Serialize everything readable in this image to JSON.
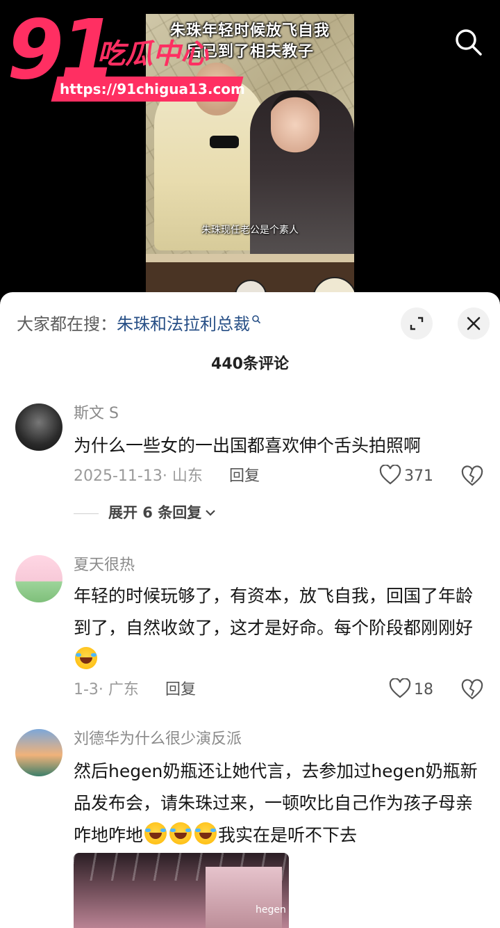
{
  "video": {
    "title_line1": "朱珠年轻时候放飞自我",
    "title_line2": "后已到了相夫教子",
    "caption": "朱珠现任老公是个素人"
  },
  "watermark": {
    "number": "91",
    "name": "吃瓜中心",
    "url": "https://91chigua13.com",
    "color": "#ff2f62"
  },
  "header": {
    "search_icon": "search-icon"
  },
  "sheet": {
    "search_label": "大家都在搜：",
    "search_term": "朱珠和法拉利总裁",
    "search_term_color": "#274f86",
    "expand_icon": "expand-icon",
    "close_icon": "close-icon",
    "count": "440条评论"
  },
  "comments": [
    {
      "user": "斯文 S",
      "text": "为什么一些女的一出国都喜欢伸个舌头拍照啊",
      "meta": "2025-11-13· 山东",
      "reply": "回复",
      "likes": "371",
      "expand": "展开 6 条回复"
    },
    {
      "user": "夏天很热",
      "text": "年轻的时候玩够了，有资本，放飞自我，回国了年龄到了，自然收敛了，这才是好命。每个阶段都刚刚好",
      "meta": "1-3· 广东",
      "reply": "回复",
      "likes": "18"
    },
    {
      "user": "刘德华为什么很少演反派",
      "text_a": "然后hegen奶瓶还让她代言，去参加过hegen奶瓶新品发布会，请朱珠过来，一顿吹比自己作为孩子母亲咋地咋地",
      "text_b": "我实在是听不下去",
      "image_text": "hegen"
    }
  ]
}
